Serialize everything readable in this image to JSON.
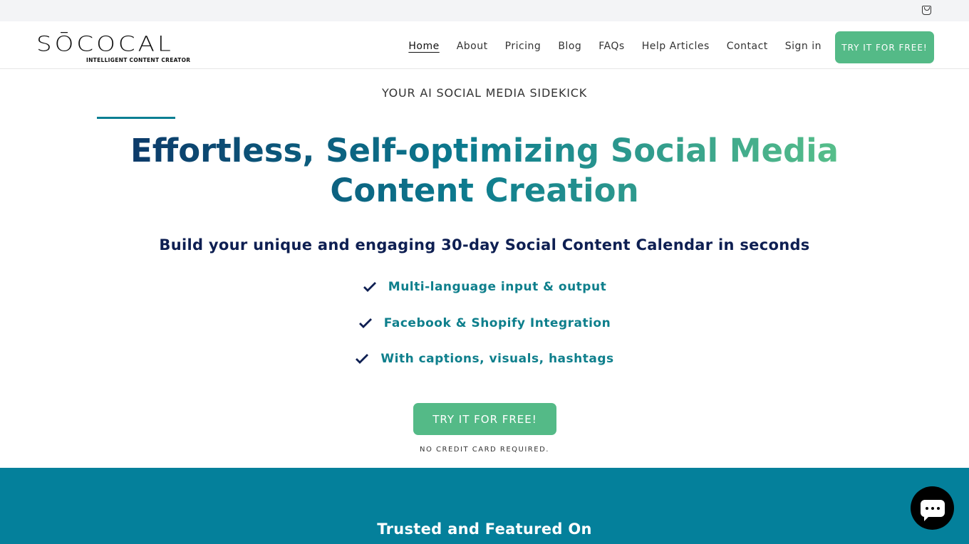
{
  "topbar": {
    "cart_icon": "shopping-bag-icon"
  },
  "header": {
    "logo_text": "SŌCOCAL",
    "logo_tagline": "INTELLIGENT CONTENT CREATOR",
    "nav": [
      {
        "label": "Home",
        "active": true
      },
      {
        "label": "About"
      },
      {
        "label": "Pricing"
      },
      {
        "label": "Blog"
      },
      {
        "label": "FAQs"
      },
      {
        "label": "Help Articles"
      },
      {
        "label": "Contact"
      },
      {
        "label": "Sign in"
      }
    ],
    "cta": "TRY IT FOR FREE!"
  },
  "hero": {
    "eyebrow": "YOUR AI SOCIAL MEDIA SIDEKICK",
    "title": "Effortless, Self-optimizing Social Media Content Creation",
    "subtitle": "Build your unique and engaging 30-day Social Content Calendar in seconds",
    "features": [
      "Multi-language input & output",
      "Facebook & Shopify Integration",
      "With captions, visuals, hashtags"
    ],
    "cta": "TRY IT FOR FREE!",
    "note": "NO CREDIT CARD REQUIRED."
  },
  "trusted": {
    "title": "Trusted and Featured On"
  },
  "colors": {
    "accent_green": "#54ba87",
    "teal": "#04809b",
    "navy": "#0e1f52"
  },
  "chat": {
    "icon": "chat-bubble-icon"
  }
}
